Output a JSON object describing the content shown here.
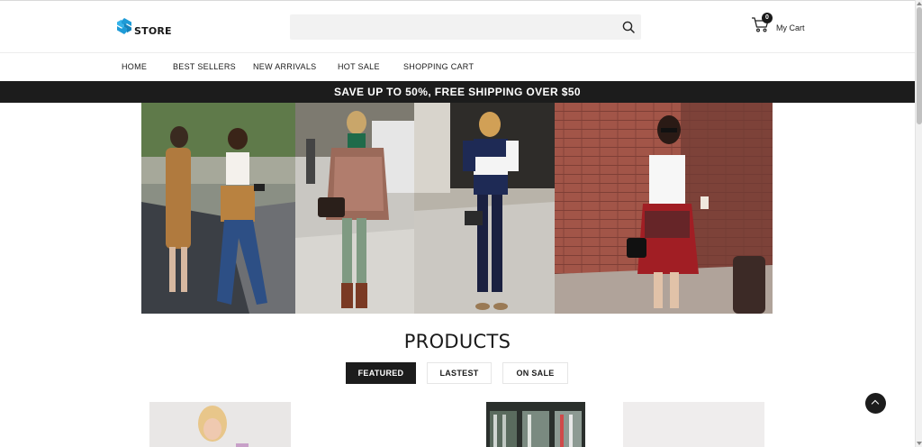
{
  "header": {
    "logo_text": "STORE",
    "search": {
      "placeholder": "",
      "value": ""
    },
    "cart": {
      "count": "0",
      "label": "My Cart"
    }
  },
  "nav": {
    "items": [
      "HOME",
      "BEST SELLERS",
      "NEW ARRIVALS",
      "HOT SALE",
      "SHOPPING CART"
    ]
  },
  "promo": {
    "text": "SAVE UP TO 50%, FREE SHIPPING OVER $50"
  },
  "products": {
    "title": "PRODUCTS",
    "tabs": [
      "FEATURED",
      "LASTEST",
      "ON SALE"
    ],
    "active_tab": "FEATURED"
  },
  "icons": {
    "logo": "store-logo-icon",
    "search": "search-icon",
    "cart": "shopping-cart-icon",
    "back_to_top": "chevron-up-icon"
  },
  "colors": {
    "accent_dark": "#1c1c1c",
    "logo_blue": "#1e9bd7",
    "search_bg": "#f2f2f2"
  }
}
